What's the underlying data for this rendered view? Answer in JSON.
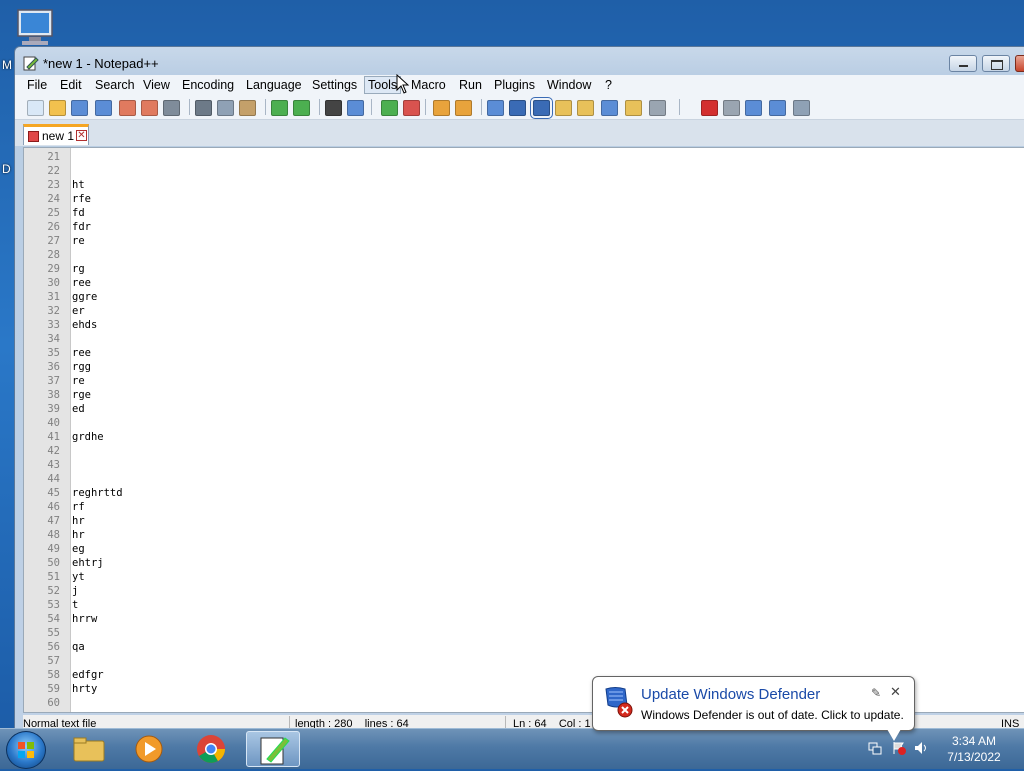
{
  "desktop": {
    "left_letters": [
      "M",
      "D"
    ]
  },
  "window": {
    "title": "*new 1 - Notepad++",
    "menu": [
      "File",
      "Edit",
      "Search",
      "View",
      "Encoding",
      "Language",
      "Settings",
      "Tools",
      "Macro",
      "Run",
      "Plugins",
      "Window",
      "?"
    ],
    "active_menu": "Tools"
  },
  "toolbar_icons": [
    "new-file-icon",
    "open-file-icon",
    "save-icon",
    "save-all-icon",
    "close-icon",
    "close-all-icon",
    "print-icon",
    "cut-icon",
    "copy-icon",
    "paste-icon",
    "undo-icon",
    "redo-icon",
    "find-icon",
    "replace-icon",
    "zoom-in-icon",
    "zoom-out-icon",
    "sync-vertical-icon",
    "sync-horizontal-icon",
    "word-wrap-icon",
    "show-all-chars-icon",
    "indent-guide-icon",
    "udl-icon",
    "function-list-icon",
    "doc-map-icon",
    "folder-as-workspace-icon",
    "monitoring-icon",
    "record-macro-icon",
    "stop-record-icon",
    "play-macro-icon",
    "run-macro-multiple-icon",
    "save-macro-icon"
  ],
  "tab": {
    "label": "new 1"
  },
  "editor": {
    "lines": [
      {
        "n": "21",
        "t": ""
      },
      {
        "n": "22",
        "t": ""
      },
      {
        "n": "23",
        "t": "ht"
      },
      {
        "n": "24",
        "t": "rfe"
      },
      {
        "n": "25",
        "t": "fd"
      },
      {
        "n": "26",
        "t": "fdr"
      },
      {
        "n": "27",
        "t": "re"
      },
      {
        "n": "28",
        "t": ""
      },
      {
        "n": "29",
        "t": "rg"
      },
      {
        "n": "30",
        "t": "ree"
      },
      {
        "n": "31",
        "t": "ggre"
      },
      {
        "n": "32",
        "t": "er"
      },
      {
        "n": "33",
        "t": "ehds"
      },
      {
        "n": "34",
        "t": ""
      },
      {
        "n": "35",
        "t": "ree"
      },
      {
        "n": "36",
        "t": "rgg"
      },
      {
        "n": "37",
        "t": "re"
      },
      {
        "n": "38",
        "t": "rge"
      },
      {
        "n": "39",
        "t": "ed"
      },
      {
        "n": "40",
        "t": ""
      },
      {
        "n": "41",
        "t": "grdhe"
      },
      {
        "n": "42",
        "t": ""
      },
      {
        "n": "43",
        "t": ""
      },
      {
        "n": "44",
        "t": ""
      },
      {
        "n": "45",
        "t": "reghrttd"
      },
      {
        "n": "46",
        "t": "rf"
      },
      {
        "n": "47",
        "t": "hr"
      },
      {
        "n": "48",
        "t": "hr"
      },
      {
        "n": "49",
        "t": "eg"
      },
      {
        "n": "50",
        "t": "ehtrj"
      },
      {
        "n": "51",
        "t": "yt"
      },
      {
        "n": "52",
        "t": "j"
      },
      {
        "n": "53",
        "t": "t"
      },
      {
        "n": "54",
        "t": "hrrw"
      },
      {
        "n": "55",
        "t": ""
      },
      {
        "n": "56",
        "t": "qa"
      },
      {
        "n": "57",
        "t": ""
      },
      {
        "n": "58",
        "t": "edfgr"
      },
      {
        "n": "59",
        "t": "hrty"
      },
      {
        "n": "60",
        "t": ""
      }
    ]
  },
  "statusbar": {
    "file_type": "Normal text file",
    "length_lines": "length : 280    lines : 64",
    "position": "Ln : 64    Col : 1",
    "mode": "INS"
  },
  "taskbar": {
    "apps": [
      "windows-explorer",
      "windows-media-player",
      "google-chrome",
      "notepad-plus-plus"
    ],
    "time": "3:34 AM",
    "date": "7/13/2022"
  },
  "notification": {
    "title": "Update Windows Defender",
    "message": "Windows Defender is out of date. Click to update."
  }
}
